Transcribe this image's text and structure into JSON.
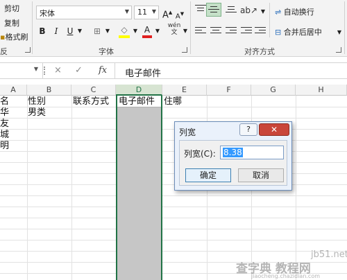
{
  "ribbon": {
    "clipboard": {
      "cut": "剪切",
      "copy": "复制",
      "format_painter": "格式刷",
      "group_label_partial": "反"
    },
    "font": {
      "name": "宋体",
      "size": "11",
      "grow": "A",
      "shrink": "A",
      "bold": "B",
      "italic": "I",
      "underline": "U",
      "color": "A",
      "group_label": "字体"
    },
    "alignment": {
      "wrap_text": "自动换行",
      "merge_center": "合并后居中",
      "group_label": "对齐方式"
    }
  },
  "formula_bar": {
    "cancel": "×",
    "enter": "✓",
    "fx": "fx",
    "content": "电子邮件"
  },
  "grid": {
    "columns": [
      "A",
      "B",
      "C",
      "D",
      "E",
      "F",
      "G",
      "H"
    ],
    "selected_column": "D",
    "cells": {
      "a1": "名",
      "b1": "性别",
      "c1": "联系方式",
      "d1": "电子邮件",
      "e1": "住哪",
      "a2": "华",
      "b2": "男类",
      "a3": "友",
      "a4": "城",
      "a5": "明"
    }
  },
  "dialog": {
    "title": "列宽",
    "help": "?",
    "close": "✕",
    "label": "列宽(C):",
    "value": "8.38",
    "ok": "确定",
    "cancel": "取消"
  },
  "watermark": {
    "site": "jb51.net",
    "text": "查字典 教程网",
    "url": "jiaocheng.chazidian.com"
  }
}
